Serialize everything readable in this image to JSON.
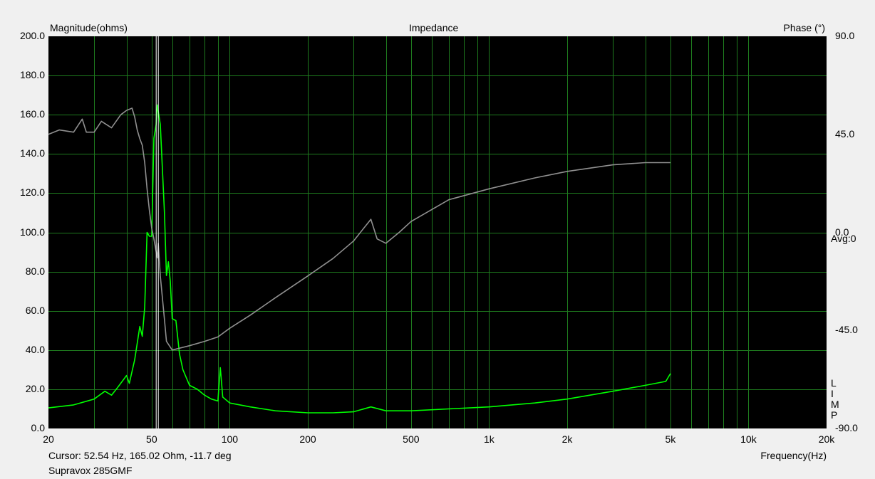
{
  "chart_data": {
    "type": "line",
    "title": "Impedance",
    "ylabel_left": "Magnitude(ohms)",
    "ylabel_right": "Phase (°)",
    "xlabel": "Frequency(Hz)",
    "x_scale": "log",
    "xlim": [
      20,
      20000
    ],
    "ylim_left": [
      0,
      200
    ],
    "ylim_right": [
      -90,
      90
    ],
    "grid": true,
    "x_ticks": [
      {
        "v": 20,
        "label": "20"
      },
      {
        "v": 50,
        "label": "50"
      },
      {
        "v": 100,
        "label": "100"
      },
      {
        "v": 200,
        "label": "200"
      },
      {
        "v": 500,
        "label": "500"
      },
      {
        "v": 1000,
        "label": "1k"
      },
      {
        "v": 2000,
        "label": "2k"
      },
      {
        "v": 5000,
        "label": "5k"
      },
      {
        "v": 10000,
        "label": "10k"
      },
      {
        "v": 20000,
        "label": "20k"
      }
    ],
    "y_ticks_left": [
      "0.0",
      "20.0",
      "40.0",
      "60.0",
      "80.0",
      "100.0",
      "120.0",
      "140.0",
      "160.0",
      "180.0",
      "200.0"
    ],
    "y_ticks_right": [
      "90.0",
      "45.0",
      "0.0",
      "-45.0",
      "-90.0"
    ],
    "right_note": "Avg:0",
    "side_legend": [
      "L",
      "I",
      "M",
      "P"
    ],
    "cursor_x": 52.54,
    "series": [
      {
        "color": "#00ff00",
        "axis": "left",
        "points": [
          [
            20,
            10.5
          ],
          [
            25,
            12
          ],
          [
            30,
            15
          ],
          [
            33,
            19
          ],
          [
            35,
            17
          ],
          [
            37,
            21
          ],
          [
            40,
            27
          ],
          [
            41,
            23
          ],
          [
            43,
            35
          ],
          [
            45,
            52
          ],
          [
            46,
            47
          ],
          [
            47,
            62
          ],
          [
            48,
            100
          ],
          [
            49,
            98
          ],
          [
            50,
            98
          ],
          [
            51,
            148
          ],
          [
            52,
            155
          ],
          [
            52.54,
            165
          ],
          [
            54,
            155
          ],
          [
            56,
            110
          ],
          [
            57,
            78
          ],
          [
            58,
            85
          ],
          [
            59,
            75
          ],
          [
            60,
            56
          ],
          [
            62,
            55
          ],
          [
            64,
            38
          ],
          [
            66,
            30
          ],
          [
            70,
            22
          ],
          [
            75,
            20
          ],
          [
            80,
            17
          ],
          [
            85,
            15
          ],
          [
            90,
            14
          ],
          [
            92,
            31
          ],
          [
            94,
            16
          ],
          [
            100,
            13
          ],
          [
            120,
            11
          ],
          [
            150,
            9
          ],
          [
            200,
            8
          ],
          [
            250,
            8
          ],
          [
            300,
            8.5
          ],
          [
            350,
            11
          ],
          [
            400,
            9
          ],
          [
            500,
            9
          ],
          [
            700,
            10
          ],
          [
            1000,
            11
          ],
          [
            1500,
            13
          ],
          [
            2000,
            15
          ],
          [
            3000,
            19
          ],
          [
            4000,
            22
          ],
          [
            4800,
            24
          ],
          [
            5000,
            28
          ]
        ]
      },
      {
        "color": "#909090",
        "axis": "right",
        "points": [
          [
            20,
            45
          ],
          [
            22,
            47
          ],
          [
            25,
            46
          ],
          [
            27,
            52
          ],
          [
            28,
            46
          ],
          [
            30,
            46
          ],
          [
            32,
            51
          ],
          [
            35,
            48
          ],
          [
            38,
            54
          ],
          [
            40,
            56
          ],
          [
            42,
            57
          ],
          [
            43,
            53
          ],
          [
            44,
            47
          ],
          [
            45,
            43
          ],
          [
            46,
            40
          ],
          [
            47,
            32
          ],
          [
            48,
            20
          ],
          [
            49,
            10
          ],
          [
            50,
            2
          ],
          [
            51,
            -3
          ],
          [
            52.54,
            -11.7
          ],
          [
            53,
            -5
          ],
          [
            54,
            -20
          ],
          [
            55,
            -30
          ],
          [
            56,
            -40
          ],
          [
            57,
            -50
          ],
          [
            60,
            -54
          ],
          [
            70,
            -52
          ],
          [
            80,
            -50
          ],
          [
            90,
            -48
          ],
          [
            100,
            -44
          ],
          [
            120,
            -38
          ],
          [
            150,
            -30
          ],
          [
            200,
            -20
          ],
          [
            250,
            -12
          ],
          [
            300,
            -4
          ],
          [
            350,
            6
          ],
          [
            370,
            -3
          ],
          [
            400,
            -5
          ],
          [
            450,
            0
          ],
          [
            500,
            5
          ],
          [
            700,
            15
          ],
          [
            1000,
            20
          ],
          [
            1500,
            25
          ],
          [
            2000,
            28
          ],
          [
            3000,
            31
          ],
          [
            4000,
            32
          ],
          [
            5000,
            32
          ]
        ]
      }
    ],
    "footer_cursor": "Cursor: 52.54 Hz, 165.02 Ohm, -11.7 deg",
    "footer_name": "Supravox 285GMF"
  }
}
